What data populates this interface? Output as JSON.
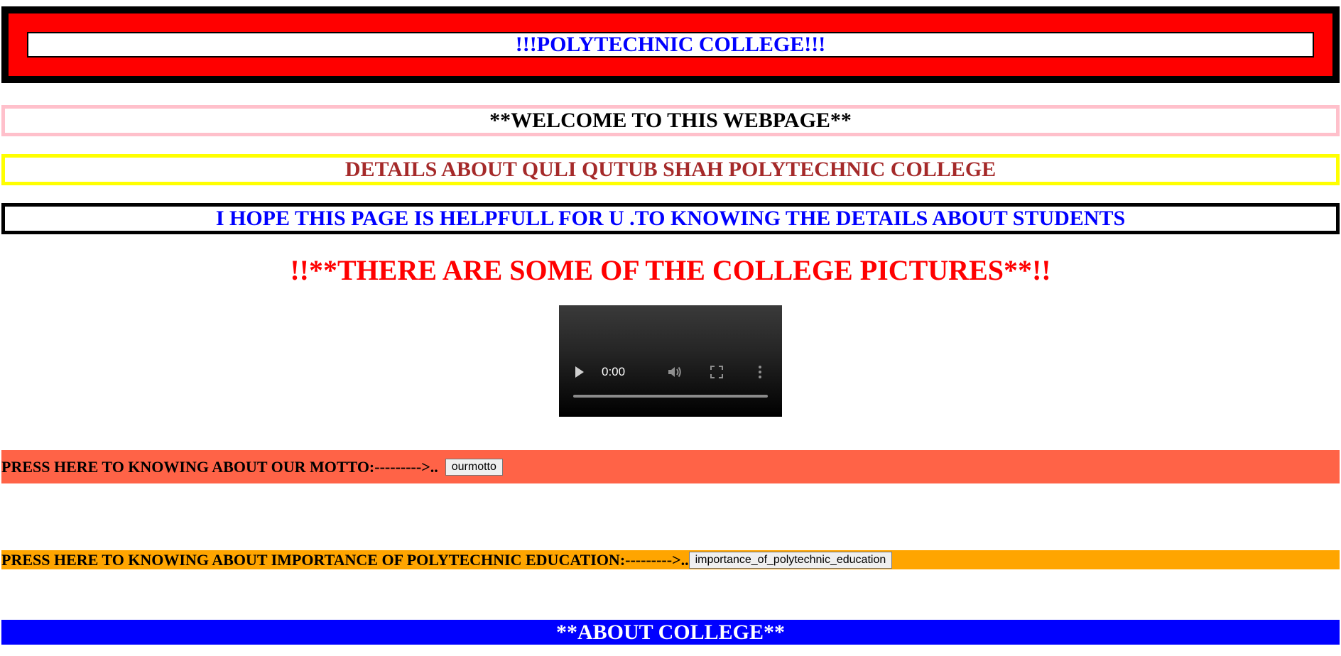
{
  "header": {
    "title": "!!!POLYTECHNIC COLLEGE!!!"
  },
  "banners": {
    "welcome": "**WELCOME TO THIS WEBPAGE**",
    "details": "DETAILS ABOUT QULI QUTUB SHAH POLYTECHNIC COLLEGE",
    "hope": "I HOPE THIS PAGE IS HELPFULL FOR U .TO KNOWING THE DETAILS ABOUT STUDENTS"
  },
  "pictures_heading": "!!**THERE ARE SOME OF THE COLLEGE PICTURES**!!",
  "video": {
    "time": "0:00",
    "icons": [
      "play-icon",
      "volume-icon",
      "fullscreen-icon",
      "more-icon"
    ]
  },
  "motto_row": {
    "label": "PRESS HERE TO KNOWING ABOUT OUR MOTTO:--------->..",
    "button": "ourmotto"
  },
  "education_row": {
    "label": "PRESS HERE TO KNOWING ABOUT IMPORTANCE OF POLYTECHNIC EDUCATION:--------->..",
    "button": "importance_of_polytechnic_education"
  },
  "about": {
    "title": "**ABOUT COLLEGE**"
  },
  "colors": {
    "header_frame": "#000000",
    "header_fill": "#ff0000",
    "header_text": "#0000ff",
    "welcome_border": "#ffc0cb",
    "details_border": "#ffff00",
    "details_text": "#a52a2a",
    "hope_border": "#000000",
    "hope_text": "#0000ff",
    "pictures_text": "#ff0000",
    "motto_bg": "#ff6347",
    "education_bg": "#ffa500",
    "about_bg": "#0000ff"
  }
}
